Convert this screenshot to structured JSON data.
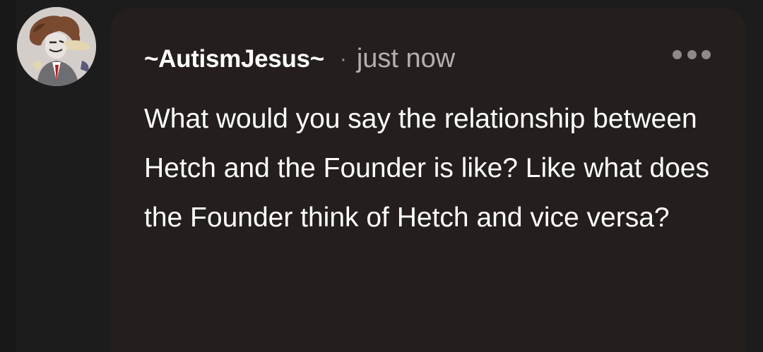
{
  "comment": {
    "author": "~AutismJesus~",
    "separator": "·",
    "timestamp": "just now",
    "text": "What would you say the relationship between Hetch and the Founder is like? Like what does the Founder think of Hetch and vice versa?",
    "more_icon": "ellipsis-icon",
    "avatar_icon": "user-avatar"
  },
  "colors": {
    "page_background": "#1c1c1c",
    "bubble_background": "#241e1d",
    "text_primary": "#ffffff",
    "text_secondary": "#b5b0ae",
    "icon_muted": "#8f8a89"
  }
}
